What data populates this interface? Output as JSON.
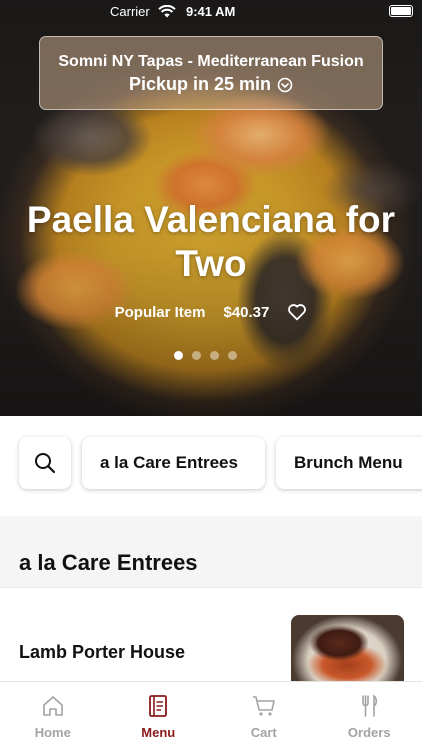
{
  "status_bar": {
    "carrier": "Carrier",
    "time": "9:41 AM"
  },
  "store": {
    "name": "Somni NY Tapas - Mediterranean Fusion",
    "pickup": "Pickup in 25 min"
  },
  "hero": {
    "title": "Paella Valenciana for Two",
    "badge": "Popular Item",
    "price": "$40.37",
    "carousel_pages": 4,
    "carousel_active_index": 0
  },
  "categories": {
    "chips": [
      {
        "label": "a la Care Entrees"
      },
      {
        "label": "Brunch Menu"
      }
    ]
  },
  "section": {
    "title": "a la Care Entrees"
  },
  "menu_items": [
    {
      "name": "Lamb Porter House"
    }
  ],
  "tab_bar": {
    "tabs": [
      {
        "label": "Home",
        "icon": "home-icon",
        "active": false
      },
      {
        "label": "Menu",
        "icon": "menu-book-icon",
        "active": true
      },
      {
        "label": "Cart",
        "icon": "cart-icon",
        "active": false
      },
      {
        "label": "Orders",
        "icon": "fork-knife-icon",
        "active": false
      }
    ]
  },
  "colors": {
    "accent": "#8a1b1b",
    "inactive_tab": "#a3a3a3",
    "background": "#f5f5f5"
  }
}
